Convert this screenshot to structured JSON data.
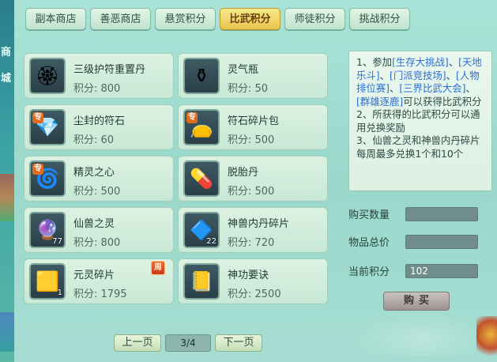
{
  "side": {
    "char1": "商",
    "char2": "城"
  },
  "tabs": [
    {
      "label": "副本商店",
      "active": false
    },
    {
      "label": "善恶商店",
      "active": false
    },
    {
      "label": "悬赏积分",
      "active": false
    },
    {
      "label": "比武积分",
      "active": true
    },
    {
      "label": "师徒积分",
      "active": false
    },
    {
      "label": "挑战积分",
      "active": false
    }
  ],
  "items": [
    {
      "name": "三级护符重置丹",
      "points": "积分: 800",
      "icon": "gold-flower-talisman-icon",
      "glyph": "🏵",
      "special": false,
      "qty": ""
    },
    {
      "name": "灵气瓶",
      "points": "积分: 50",
      "icon": "vase-icon",
      "glyph": "⚱",
      "special": false,
      "qty": ""
    },
    {
      "name": "尘封的符石",
      "points": "积分: 60",
      "icon": "gem-stone-icon",
      "glyph": "💎",
      "special": true,
      "qty": ""
    },
    {
      "name": "符石碎片包",
      "points": "积分: 500",
      "icon": "red-pouch-icon",
      "glyph": "👝",
      "special": true,
      "qty": ""
    },
    {
      "name": "精灵之心",
      "points": "积分: 500",
      "icon": "spirit-heart-icon",
      "glyph": "🌀",
      "special": true,
      "qty": ""
    },
    {
      "name": "脱胎丹",
      "points": "积分: 500",
      "icon": "pill-icon",
      "glyph": "💊",
      "special": false,
      "qty": ""
    },
    {
      "name": "仙兽之灵",
      "points": "积分: 800",
      "icon": "blue-orb-icon",
      "glyph": "🔮",
      "special": false,
      "qty": "77"
    },
    {
      "name": "神兽内丹碎片",
      "points": "积分: 720",
      "icon": "purple-crystal-icon",
      "glyph": "🔷",
      "special": false,
      "qty": "22"
    },
    {
      "name": "元灵碎片",
      "points": "积分: 1795",
      "icon": "gold-shard-icon",
      "glyph": "🟨",
      "special": false,
      "qty": "1"
    },
    {
      "name": "神功要诀",
      "points": "积分: 2500",
      "icon": "gold-book-icon",
      "glyph": "📒",
      "special": false,
      "qty": ""
    }
  ],
  "zhou_badge": "周",
  "zhuan_badge": "专",
  "pager": {
    "prev": "上一页",
    "page": "3/4",
    "next": "下一页"
  },
  "desc": {
    "line1_pre": "1、参加",
    "link1": "[生存大挑战]",
    "sep1": "、",
    "link2": "[天地乐斗]",
    "sep2": "、",
    "link3": "[门派竞技场]",
    "sep3": "、",
    "link4": "[人物排位赛]",
    "sep4": "、",
    "link5": "[三界比武大会]",
    "sep5": "、",
    "link6": "[群雄逐鹿]",
    "line1_post": "可以获得比武积分",
    "line2": "2、所获得的比武积分可以通用兑换奖励",
    "line3": "3、仙兽之灵和神兽内丹碎片每周最多兑换1个和10个"
  },
  "form": {
    "qty_label": "购买数量",
    "qty_value": "",
    "total_label": "物品总价",
    "total_value": "",
    "current_label": "当前积分",
    "current_value": "102"
  },
  "buy_label": "购买"
}
